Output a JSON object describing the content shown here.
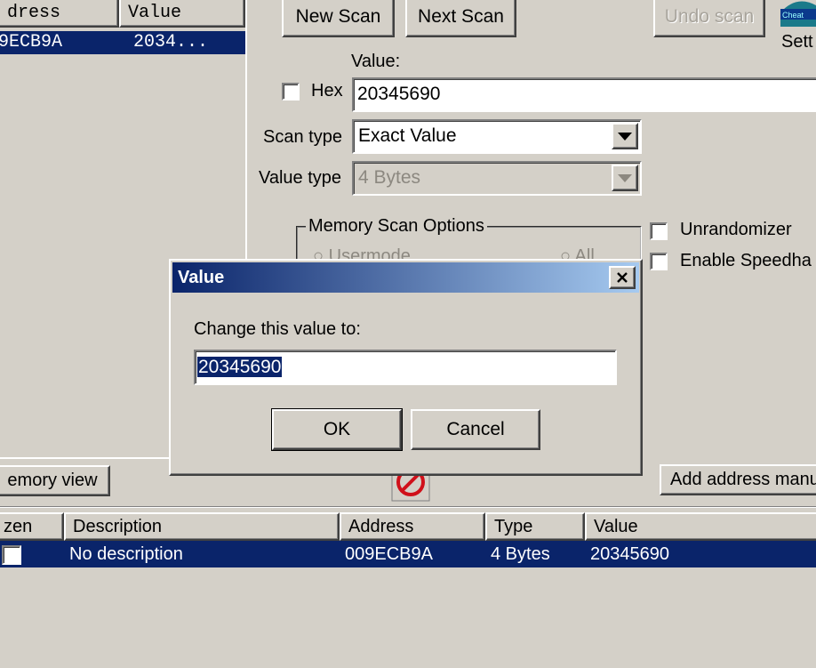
{
  "found_list": {
    "headers": {
      "address": "dress",
      "value": "Value"
    },
    "row": {
      "address": "9ECB9A",
      "value": "2034..."
    }
  },
  "scan": {
    "new_scan": "New Scan",
    "next_scan": "Next Scan",
    "undo_scan": "Undo scan",
    "settings": "Sett",
    "logo_text": "Cheat",
    "value_label": "Value:",
    "hex_label": "Hex",
    "value_input": "20345690",
    "scan_type_label": "Scan type",
    "scan_type_value": "Exact Value",
    "value_type_label": "Value type",
    "value_type_value": "4 Bytes",
    "memory_options_title": "Memory Scan Options",
    "mem_opt_usermode": "Usermode",
    "mem_opt_all": "All",
    "unrandomizer": "Unrandomizer",
    "speedhack": "Enable Speedha"
  },
  "middle": {
    "memory_view": "emory view",
    "add_address": "Add address manu"
  },
  "cheat_table": {
    "headers": {
      "frozen": "zen",
      "description": "Description",
      "address": "Address",
      "type": "Type",
      "value": "Value"
    },
    "rows": [
      {
        "description": "No description",
        "address": "009ECB9A",
        "type": "4 Bytes",
        "value": "20345690"
      }
    ]
  },
  "dialog": {
    "title": "Value",
    "prompt": "Change this value to:",
    "input_value": "20345690",
    "ok": "OK",
    "cancel": "Cancel"
  },
  "colors": {
    "face": "#d4d0c8",
    "selection": "#0a246a",
    "title_gradient_start": "#0a246a",
    "title_gradient_end": "#a6caf0",
    "stop_icon": "#d0101a"
  },
  "icons": [
    "close-icon",
    "dropdown-arrow-icon",
    "stop-icon",
    "cheat-engine-logo-icon"
  ]
}
